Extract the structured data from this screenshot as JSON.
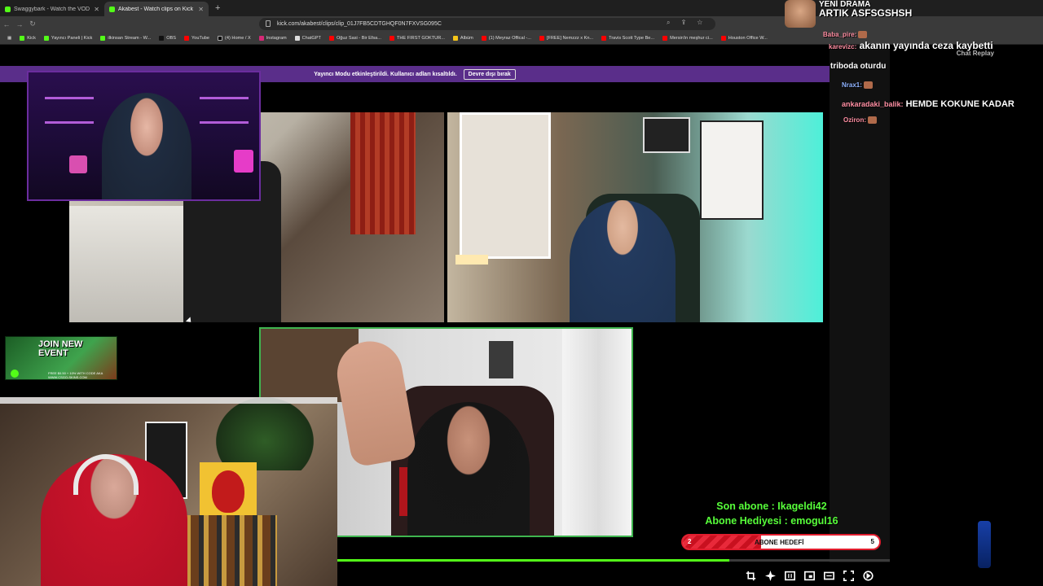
{
  "browser": {
    "tabs": [
      {
        "label": "Swaggybark - Watch the VOD on Kic",
        "active": false
      },
      {
        "label": "Akabest - Watch clips on Kick",
        "active": true
      }
    ],
    "new_tab": "+",
    "url": "kick.com/akabest/clips/clip_01J7FB5CDTGHQF0N7FXVSG095C",
    "bookmarks": [
      "Kick",
      "Yayıncı Paneli | Kick",
      "ilkinsan Stream - W...",
      "OBS",
      "YouTube",
      "(4) Home / X",
      "Instagram",
      "ChatGPT",
      "Oğuz Sasi - Bir Efsa...",
      "THE FIRST GOKTUR...",
      "Albüm",
      "(1) Meyraz Offical -...",
      "[FREE] Nemzzz x Kn...",
      "Travis Scott Type Be...",
      "Mersin'in meşhur ci...",
      "Houston Office W..."
    ],
    "bookmarks_right": "Bookmarks"
  },
  "banner": {
    "text": "Yayıncı Modu etkinleştirildi. Kullanıcı adları kısaltıldı.",
    "button": "Devre dışı bırak"
  },
  "chat": {
    "replay_label": "Chat Replay",
    "messages": [
      {
        "user": "",
        "text": "YENİ DRAMA",
        "style": "top"
      },
      {
        "user": "",
        "text": "ARTIK ASFSGSHSH",
        "style": "top"
      },
      {
        "user": "Baba_pire:",
        "text": "",
        "style": "small"
      },
      {
        "user": "karevizc:",
        "text": "akanın yayında ceza kaybetti",
        "style": "big"
      },
      {
        "user": "",
        "text": "triboda oturdu",
        "style": "big"
      },
      {
        "user": "Nrax1:",
        "text": "",
        "style": "small"
      },
      {
        "user": "ankaradaki_balik:",
        "text": "HEMDE KOKUNE KADAR",
        "style": "big"
      },
      {
        "user": "Oziron:",
        "text": "",
        "style": "small"
      }
    ]
  },
  "ad": {
    "title_line1": "JOIN NEW",
    "title_line2": "EVENT",
    "subtitle": "FREE $0.50 + 10% WITH CODE AKA",
    "site": "WWW.CSGO-SKINS.COM"
  },
  "alerts": {
    "last_sub": "Son abone : Ikageldi42",
    "gift_sub": "Abone Hediyesi : emogul16"
  },
  "sub_goal": {
    "current": "2",
    "label": "ABONE HEDEFİ",
    "target": "5",
    "progress": 0.4
  },
  "player": {
    "progress": 0.71,
    "controls": [
      "crop-icon",
      "sparkle-icon",
      "theater-icon",
      "pip-icon",
      "mini-player-icon",
      "fullscreen-icon",
      "settings-icon"
    ]
  },
  "colors": {
    "kick_green": "#53fc18",
    "banner_purple": "#5a2e8a",
    "alert_green": "#57ff3a",
    "goal_red": "#e11d2e"
  }
}
